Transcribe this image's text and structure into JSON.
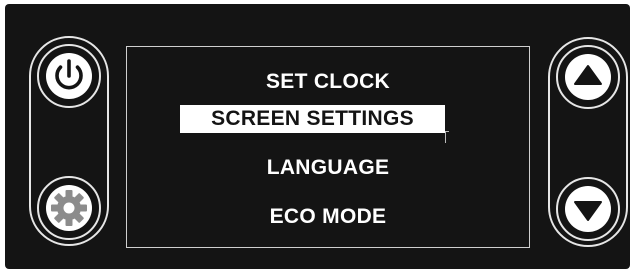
{
  "menu": {
    "items": [
      {
        "label": "SET CLOCK",
        "selected": false
      },
      {
        "label": "SCREEN SETTINGS",
        "selected": true
      },
      {
        "label": "LANGUAGE",
        "selected": false
      },
      {
        "label": "ECO MODE",
        "selected": false
      }
    ]
  },
  "controls": {
    "left": [
      "power-icon",
      "gear-icon"
    ],
    "right": [
      "arrow-up-icon",
      "arrow-down-icon"
    ]
  },
  "colors": {
    "panel_background": "#141414",
    "foreground": "#ffffff",
    "outline": "#e6e6e6",
    "icon_gray": "#8c8c8c"
  }
}
